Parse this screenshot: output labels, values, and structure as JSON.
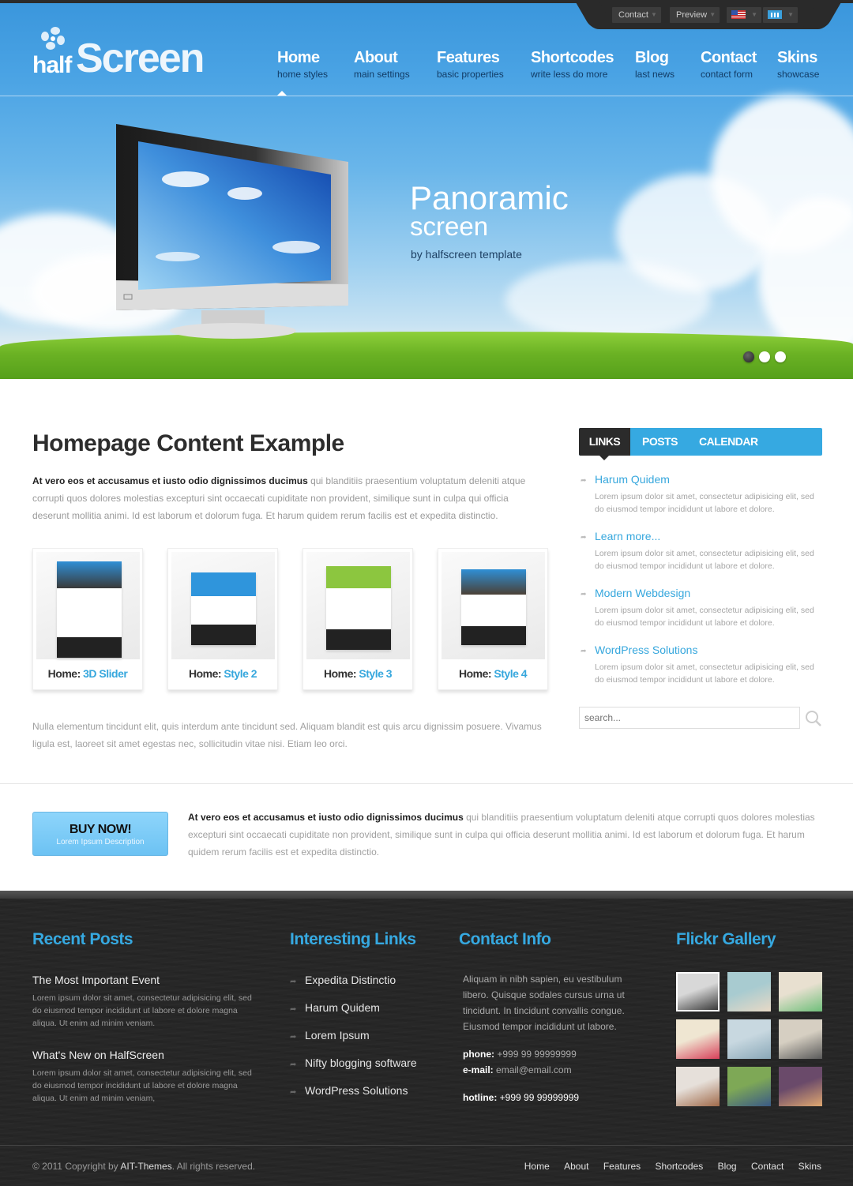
{
  "topbar": {
    "contact_label": "Contact",
    "preview_label": "Preview",
    "language": "English (US)",
    "skin": "Blue skin"
  },
  "logo": {
    "part1": "half",
    "part2": "Screen"
  },
  "nav": [
    {
      "title": "Home",
      "subtitle": "home styles",
      "active": true
    },
    {
      "title": "About",
      "subtitle": "main settings"
    },
    {
      "title": "Features",
      "subtitle": "basic properties"
    },
    {
      "title": "Shortcodes",
      "subtitle": "write less do more"
    },
    {
      "title": "Blog",
      "subtitle": "last news"
    },
    {
      "title": "Contact",
      "subtitle": "contact form"
    },
    {
      "title": "Skins",
      "subtitle": "showcase"
    }
  ],
  "hero": {
    "title": "Panoramic",
    "subtitle": "screen",
    "byline": "by halfscreen template",
    "slides_total": 3,
    "active_slide": 1
  },
  "main": {
    "title": "Homepage Content Example",
    "intro_bold": "At vero eos et accusamus et iusto odio dignissimos ducimus",
    "intro_rest": " qui blanditiis praesentium voluptatum deleniti atque corrupti quos dolores molestias excepturi sint occaecati cupiditate non provident, similique sunt in culpa qui officia deserunt mollitia animi. Id est laborum et dolorum fuga. Et harum quidem rerum facilis est et expedita distinctio.",
    "thumbs": [
      {
        "prefix": "Home:",
        "label": "3D Slider",
        "accent": "#3a8fd8"
      },
      {
        "prefix": "Home:",
        "label": "Style 2",
        "accent": "#3a9be0"
      },
      {
        "prefix": "Home:",
        "label": "Style 3",
        "accent": "#8cc63f"
      },
      {
        "prefix": "Home:",
        "label": "Style 4",
        "accent": "#3a8fd8"
      }
    ],
    "outro": "Nulla elementum tincidunt elit, quis interdum ante tincidunt sed. Aliquam blandit est quis arcu dignissim posuere. Vivamus ligula est, laoreet sit amet egestas nec, sollicitudin vitae nisi. Etiam leo orci."
  },
  "sidebar": {
    "tabs": [
      {
        "label": "LINKS",
        "active": true
      },
      {
        "label": "POSTS"
      },
      {
        "label": "CALENDAR"
      }
    ],
    "items": [
      {
        "title": "Harum Quidem",
        "desc": "Lorem ipsum dolor sit amet, consectetur adipisicing elit, sed do eiusmod tempor incididunt ut labore et dolore."
      },
      {
        "title": "Learn more...",
        "desc": "Lorem ipsum dolor sit amet, consectetur adipisicing elit, sed do eiusmod tempor incididunt ut labore et dolore."
      },
      {
        "title": "Modern Webdesign",
        "desc": "Lorem ipsum dolor sit amet, consectetur adipisicing elit, sed do eiusmod tempor incididunt ut labore et dolore."
      },
      {
        "title": "WordPress Solutions",
        "desc": "Lorem ipsum dolor sit amet, consectetur adipisicing elit, sed do eiusmod tempor incididunt ut labore et dolore."
      }
    ],
    "search_placeholder": "search..."
  },
  "buy": {
    "button_title": "BUY NOW!",
    "button_sub": "Lorem Ipsum Description",
    "text_bold": "At vero eos et accusamus et iusto odio dignissimos ducimus",
    "text_rest": " qui blanditiis praesentium voluptatum deleniti atque corrupti quos dolores molestias excepturi sint occaecati cupiditate non provident, similique sunt in culpa qui officia deserunt mollitia animi. Id est laborum et dolorum fuga. Et harum quidem rerum facilis est et expedita distinctio."
  },
  "footer": {
    "recent_posts": {
      "heading": "Recent Posts",
      "posts": [
        {
          "title": "The Most Important Event",
          "desc": "Lorem ipsum dolor sit amet, consectetur adipisicing elit, sed do eiusmod tempor incididunt ut labore et dolore magna aliqua. Ut enim ad minim veniam."
        },
        {
          "title": "What's New on HalfScreen",
          "desc": "Lorem ipsum dolor sit amet, consectetur adipisicing elit, sed do eiusmod tempor incididunt ut labore et dolore magna aliqua. Ut enim ad minim veniam,"
        }
      ]
    },
    "links": {
      "heading": "Interesting Links",
      "items": [
        "Expedita Distinctio",
        "Harum Quidem",
        "Lorem Ipsum",
        "Nifty blogging software",
        "WordPress Solutions"
      ]
    },
    "contact": {
      "heading": "Contact Info",
      "desc": "Aliquam in nibh sapien, eu vestibulum libero. Quisque sodales cursus urna ut tincidunt. In tincidunt convallis congue. Eiusmod tempor incididunt ut labore.",
      "phone_label": "phone:",
      "phone": "+999 99 99999999",
      "email_label": "e-mail:",
      "email": "email@email.com",
      "hotline_label": "hotline:",
      "hotline": "+999 99 99999999"
    },
    "gallery": {
      "heading": "Flickr Gallery",
      "photos": [
        {
          "name": "window-bw",
          "c1": "#d8d8d8",
          "c2": "#3a3a3a"
        },
        {
          "name": "sky",
          "c1": "#a8cbd0",
          "c2": "#e8d9c6"
        },
        {
          "name": "green-van",
          "c1": "#e8e0d0",
          "c2": "#6fbf7a"
        },
        {
          "name": "red-van",
          "c1": "#efe6d2",
          "c2": "#d8405a"
        },
        {
          "name": "power-lines",
          "c1": "#c8d8e0",
          "c2": "#8aa8b8"
        },
        {
          "name": "stairs",
          "c1": "#d6cfc2",
          "c2": "#5a5a5a"
        },
        {
          "name": "bulldog",
          "c1": "#e6e0da",
          "c2": "#a06a4a"
        },
        {
          "name": "man-dog",
          "c1": "#7ea856",
          "c2": "#3a5a86"
        },
        {
          "name": "legs-light",
          "c1": "#6a4a6a",
          "c2": "#e0a870"
        }
      ]
    },
    "copyright_pre": "© 2011 Copyright by ",
    "copyright_brand": "AIT-Themes",
    "copyright_post": ". All rights reserved.",
    "nav": [
      "Home",
      "About",
      "Features",
      "Shortcodes",
      "Blog",
      "Contact",
      "Skins"
    ]
  }
}
